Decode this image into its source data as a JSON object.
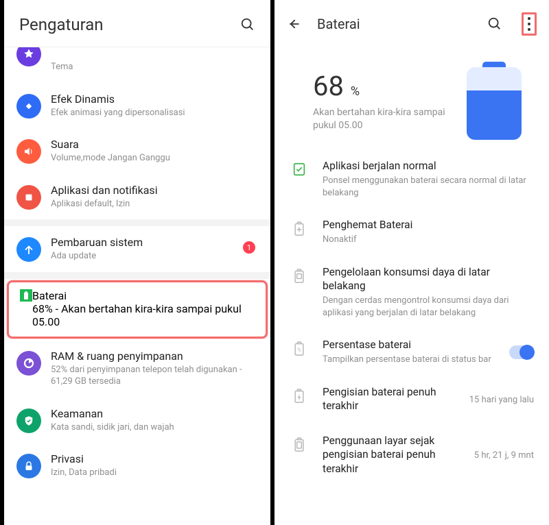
{
  "left": {
    "title": "Pengaturan",
    "items": [
      {
        "name": "tema",
        "title": "",
        "subtitle": "Tema"
      },
      {
        "name": "efek",
        "title": "Efek Dinamis",
        "subtitle": "Efek animasi yang dipersonalisasi"
      },
      {
        "name": "suara",
        "title": "Suara",
        "subtitle": "Volume,mode Jangan Ganggu"
      },
      {
        "name": "aplikasi",
        "title": "Aplikasi dan notifikasi",
        "subtitle": "Aplikasi default, Izin"
      },
      {
        "name": "pembaruan",
        "title": "Pembaruan sistem",
        "subtitle": "Ada update",
        "badge": "1"
      },
      {
        "name": "baterai",
        "title": "Baterai",
        "subtitle": "68% - Akan bertahan kira-kira sampai pukul 05.00"
      },
      {
        "name": "ram",
        "title": "RAM & ruang penyimpanan",
        "subtitle": "52% dari penyimpanan telepon telah digunakan - 61,29 GB tersedia"
      },
      {
        "name": "keamanan",
        "title": "Keamanan",
        "subtitle": "Kata sandi, sidik jari, dan wajah"
      },
      {
        "name": "privasi",
        "title": "Privasi",
        "subtitle": "Izin, Data pribadi"
      }
    ]
  },
  "right": {
    "title": "Baterai",
    "battery": {
      "percent_num": "68",
      "percent_sym": "%",
      "subtitle": "Akan bertahan kira-kira sampai pukul 05.00",
      "fill_pct": 68
    },
    "items": [
      {
        "name": "app-normal",
        "title": "Aplikasi berjalan normal",
        "subtitle": "Ponsel menggunakan baterai secara normal di latar belakang"
      },
      {
        "name": "penghemat",
        "title": "Penghemat Baterai",
        "subtitle": "Nonaktif"
      },
      {
        "name": "pengelolaan",
        "title": "Pengelolaan konsumsi daya di latar belakang",
        "subtitle": "Dengan cerdas mengontrol konsumsi daya dari aplikasi yang berjalan di latar belakang"
      },
      {
        "name": "persentase",
        "title": "Persentase baterai",
        "subtitle": "Tampilkan persentase baterai di status bar",
        "toggle": true
      },
      {
        "name": "pengisian",
        "title": "Pengisian baterai penuh terakhir",
        "value": "15 hari yang lalu"
      },
      {
        "name": "layar",
        "title": "Penggunaan layar sejak pengisian baterai penuh terakhir",
        "value": "5 hr, 21 j, 9 mnt"
      }
    ]
  }
}
